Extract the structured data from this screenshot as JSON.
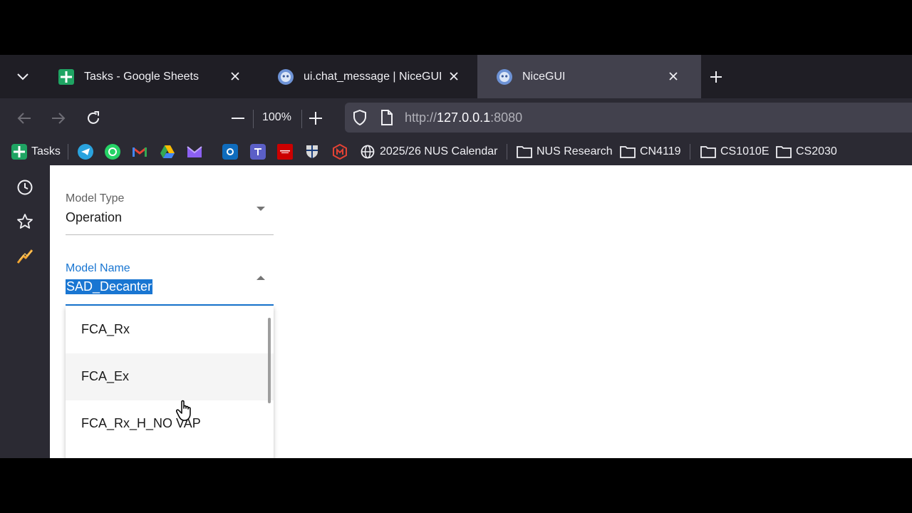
{
  "browser": {
    "tabs": [
      {
        "title": "Tasks - Google Sheets",
        "icon": "google-sheets-icon",
        "active": false
      },
      {
        "title": "ui.chat_message | NiceGUI",
        "icon": "nicegui-icon",
        "active": false
      },
      {
        "title": "NiceGUI",
        "icon": "nicegui-icon",
        "active": true
      }
    ],
    "zoom": "100%",
    "url": {
      "scheme": "http://",
      "host": "127.0.0.1",
      "port": ":8080"
    },
    "bookmarks": [
      {
        "label": "Tasks",
        "icon": "google-sheets-icon"
      },
      {
        "label": "",
        "icon": "telegram-icon"
      },
      {
        "label": "",
        "icon": "whatsapp-icon"
      },
      {
        "label": "",
        "icon": "gmail-icon"
      },
      {
        "label": "",
        "icon": "google-drive-icon"
      },
      {
        "label": "",
        "icon": "proton-mail-icon"
      },
      {
        "label": "",
        "icon": "outlook-icon"
      },
      {
        "label": "",
        "icon": "teams-icon"
      },
      {
        "label": "",
        "icon": "oracle-peoplesoft-icon"
      },
      {
        "label": "",
        "icon": "nus-crest-icon"
      },
      {
        "label": "",
        "icon": "m-shield-icon"
      },
      {
        "label": "2025/26 NUS Calendar",
        "icon": "globe-icon"
      },
      {
        "label": "NUS Research",
        "icon": "folder-icon"
      },
      {
        "label": "CN4119",
        "icon": "folder-icon"
      },
      {
        "label": "CS1010E",
        "icon": "folder-icon"
      },
      {
        "label": "CS2030",
        "icon": "folder-icon"
      }
    ]
  },
  "sidebar": {
    "items": [
      {
        "icon": "history-clock-icon"
      },
      {
        "icon": "bookmark-star-icon"
      },
      {
        "icon": "extension-bolt-icon"
      }
    ]
  },
  "form": {
    "model_type": {
      "label": "Model Type",
      "value": "Operation"
    },
    "model_name": {
      "label": "Model Name",
      "value": "SAD_Decanter"
    },
    "options": [
      "FCA_Rx",
      "FCA_Ex",
      "FCA_Rx_H_NO VAP"
    ]
  },
  "colors": {
    "accent": "#1976d2",
    "selection": "#1976d2",
    "tab_active": "#42414d",
    "tab_strip": "#1f1e25",
    "toolbar": "#2b2a33"
  }
}
